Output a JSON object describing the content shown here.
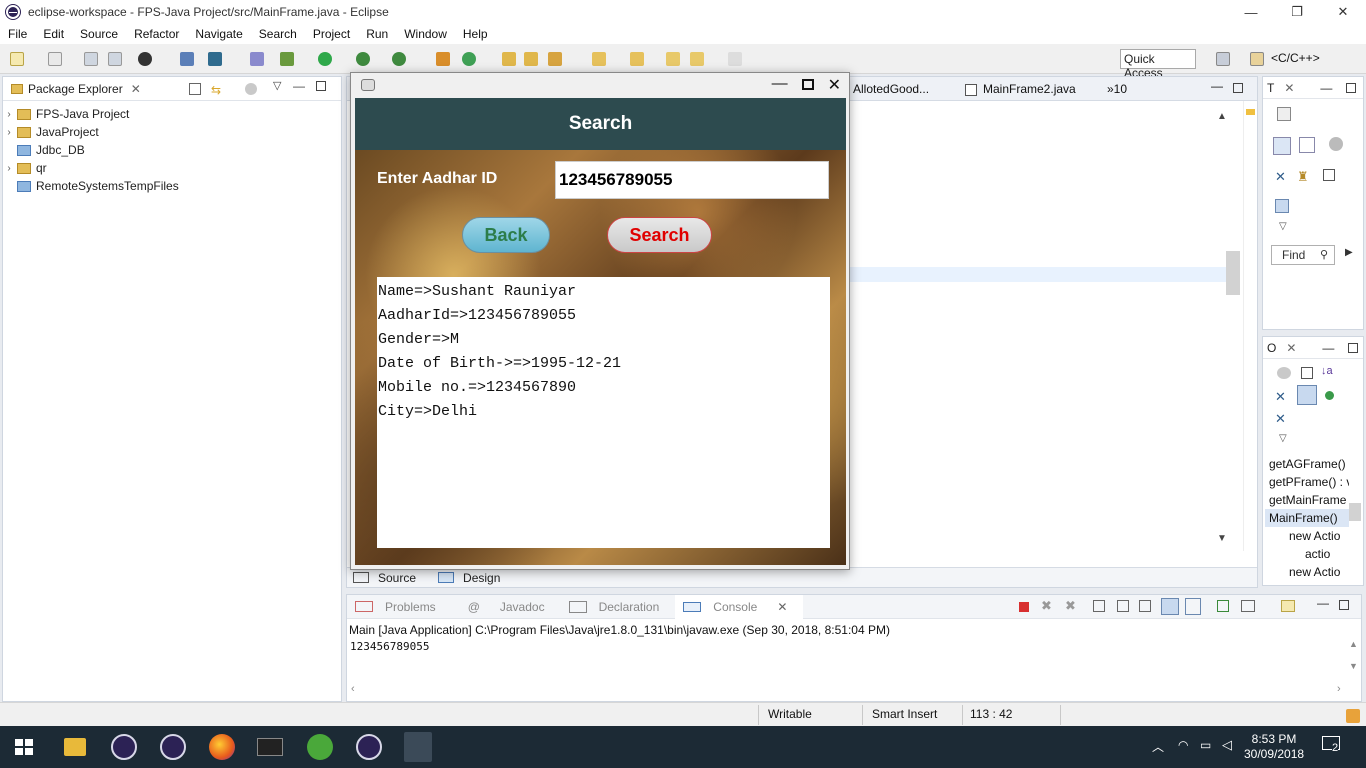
{
  "window": {
    "title": "eclipse-workspace - FPS-Java Project/src/MainFrame.java - Eclipse",
    "minimize": "—",
    "maximize": "❐",
    "close": "✕"
  },
  "menu": [
    "File",
    "Edit",
    "Source",
    "Refactor",
    "Navigate",
    "Search",
    "Project",
    "Run",
    "Window",
    "Help"
  ],
  "toolbar": {
    "quick_access": "Quick Access",
    "perspective": "<C/C++>"
  },
  "package_explorer": {
    "title": "Package Explorer",
    "items": [
      {
        "label": "FPS-Java Project",
        "expandable": true
      },
      {
        "label": "JavaProject",
        "expandable": true
      },
      {
        "label": "Jdbc_DB",
        "expandable": false
      },
      {
        "label": "qr",
        "expandable": true
      },
      {
        "label": "RemoteSystemsTempFiles",
        "expandable": false
      }
    ]
  },
  "editor": {
    "tabs": [
      "AllotedGood...",
      "MainFrame2.java",
      "»10"
    ],
    "bottom_tabs": [
      "Source",
      "Design"
    ]
  },
  "right_top": {
    "title": "T",
    "find_label": "Find"
  },
  "outline": {
    "title": "O",
    "items": [
      "getAGFrame()",
      "getPFrame() : v",
      "getMainFrame",
      "MainFrame()",
      "new Actio",
      "actio",
      "new Actio"
    ]
  },
  "console": {
    "tabs": [
      "Problems",
      "Javadoc",
      "Declaration",
      "Console"
    ],
    "launch_line": "Main [Java Application] C:\\Program Files\\Java\\jre1.8.0_131\\bin\\javaw.exe (Sep 30, 2018, 8:51:04 PM)",
    "output": "123456789055"
  },
  "status": {
    "writable": "Writable",
    "insert_mode": "Smart Insert",
    "position": "113 : 42"
  },
  "taskbar": {
    "time": "8:53 PM",
    "date": "30/09/2018",
    "notifications": "2"
  },
  "dialog": {
    "header": "Search",
    "aadhar_label": "Enter Aadhar ID",
    "aadhar_value": "123456789055",
    "back_label": "Back",
    "search_label": "Search",
    "result_lines": [
      "Name=>Sushant Rauniyar",
      "AadharId=>123456789055",
      "Gender=>M",
      "Date of Birth->=>1995-12-21",
      "Mobile no.=>1234567890",
      "City=>Delhi"
    ]
  }
}
